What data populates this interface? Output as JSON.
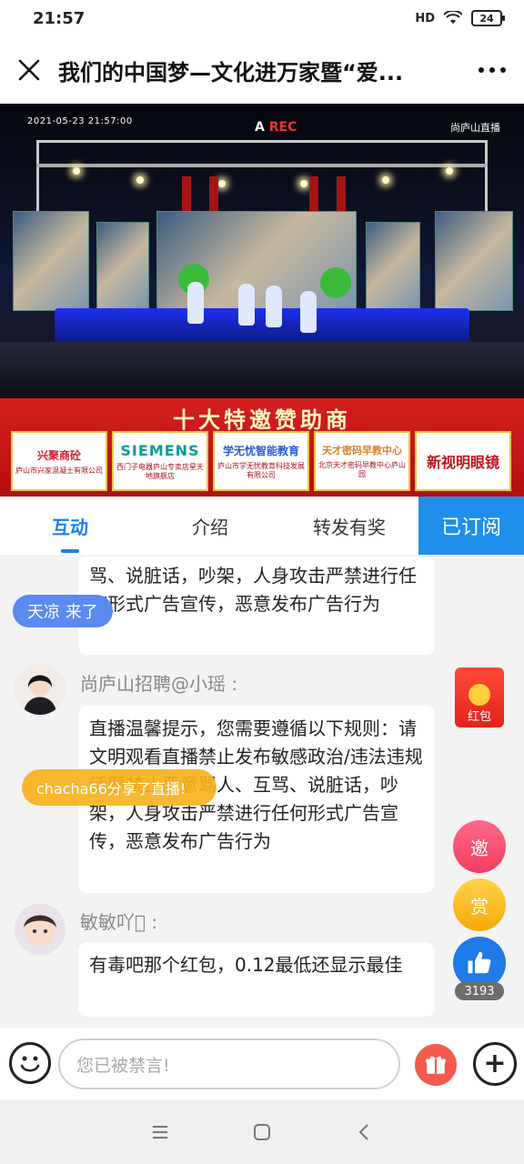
{
  "status": {
    "time": "21:57",
    "signal": "HD",
    "battery": "24"
  },
  "header": {
    "title": "我们的中国梦—文化进万家暨“爱..."
  },
  "video": {
    "timestamp": "2021-05-23  21:57:00",
    "rec": "REC",
    "watermark": "尚庐山直播"
  },
  "sponsor": {
    "title": "十大特邀赞助商",
    "cards": [
      {
        "brand": "兴聚商砼",
        "sub": "庐山市兴家混凝土有限公司"
      },
      {
        "brand": "SIEMENS",
        "sub": "西门子电器庐山专卖店星天地旗舰店"
      },
      {
        "brand": "学无忧智能教育",
        "sub": "庐山市学无忧教育科技发展有限公司"
      },
      {
        "brand": "天才密码早教中心",
        "sub": "北京天才密码早教中心庐山园"
      },
      {
        "brand": "新视明眼镜",
        "sub": ""
      }
    ]
  },
  "tabs": [
    {
      "label": "互动"
    },
    {
      "label": "介绍"
    },
    {
      "label": "转发有奖"
    }
  ],
  "subscribe": {
    "label": "已订阅"
  },
  "chat": {
    "messages": [
      {
        "text": "骂、说脏话，吵架，人身攻击严禁进行任何形式广告宣传，恶意发布广告行为"
      },
      {
        "sender": "尚庐山招聘@小瑶 :",
        "text": "直播温馨提示，您需要遵循以下规则：请文明观看直播禁止发布敏感政治/违法违规话题禁止恶意骂人、互骂、说脏话，吵架，人身攻击严禁进行任何形式广告宣传，恶意发布广告行为"
      },
      {
        "sender": "敏敏吖\u0000 :",
        "text": "有毒吧那个红包，0.12最低还显示最佳"
      }
    ],
    "join_notice": "天凉 来了",
    "share_notice": "chacha66分享了直播!"
  },
  "floats": {
    "redpack": "红包",
    "invite": "邀",
    "reward": "赏",
    "like_count": "3193"
  },
  "input": {
    "placeholder": "您已被禁言!"
  }
}
